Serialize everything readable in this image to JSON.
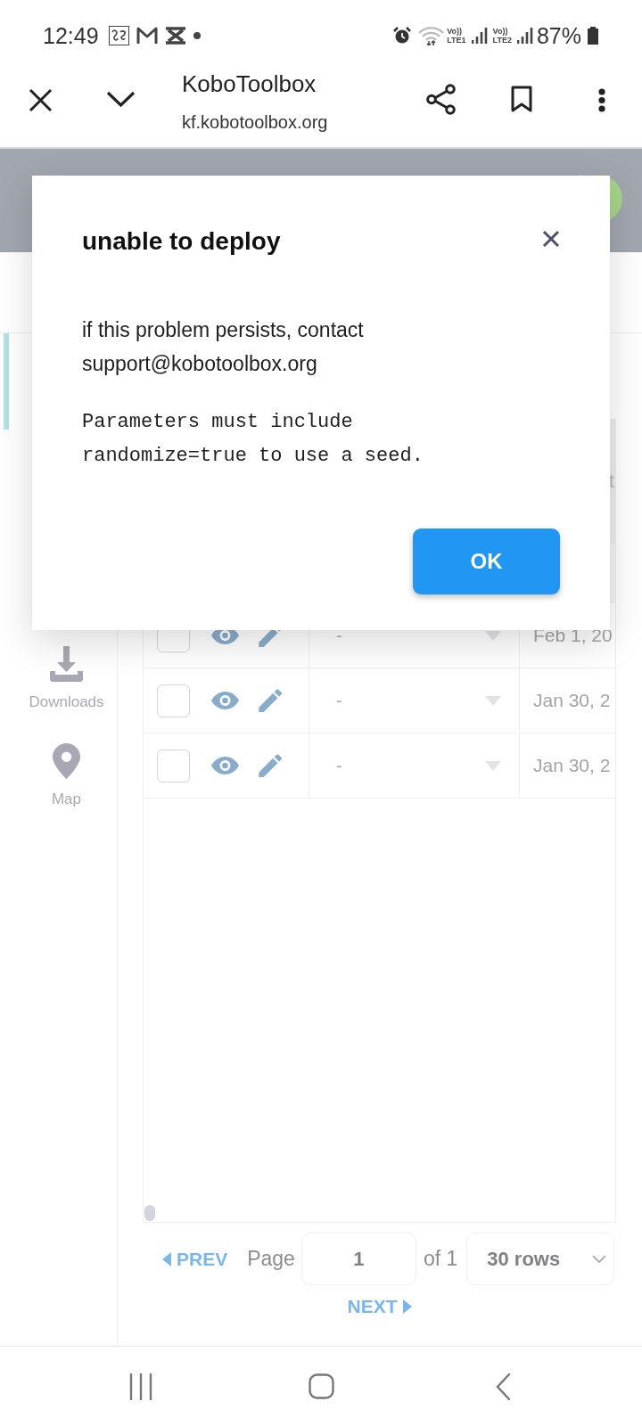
{
  "status_bar": {
    "time": "12:49",
    "sims": [
      {
        "volte": "Vo))",
        "network": "LTE1"
      },
      {
        "volte": "Vo))",
        "network": "LTE2"
      }
    ],
    "battery": "87%"
  },
  "browser_bar": {
    "title": "KoboToolbox",
    "url": "kf.kobotoolbox.org"
  },
  "sidebar": {
    "items": [
      {
        "kind": "downloads",
        "label": "Downloads"
      },
      {
        "kind": "map",
        "label": "Map"
      }
    ]
  },
  "table": {
    "column_3_heading": "t",
    "rows": [
      {
        "checked": false,
        "value": "-",
        "date": "Feb 1, 20"
      },
      {
        "checked": false,
        "value": "-",
        "date": "Jan 30, 2"
      },
      {
        "checked": false,
        "value": "-",
        "date": "Jan 30, 2"
      }
    ]
  },
  "pagination": {
    "prev": {
      "label": "PREV",
      "disabled": true
    },
    "page_label": "Page",
    "page_value": "1",
    "of_label": "of 1",
    "rows_select": "30 rows",
    "next": {
      "label": "NEXT",
      "disabled": true
    }
  },
  "dialog": {
    "title": "unable to deploy",
    "message": "if this problem persists, contact support@kobotoolbox.org",
    "detail": "Parameters must include\nrandomize=true to use a seed.",
    "buttons": [
      "OK"
    ]
  }
}
